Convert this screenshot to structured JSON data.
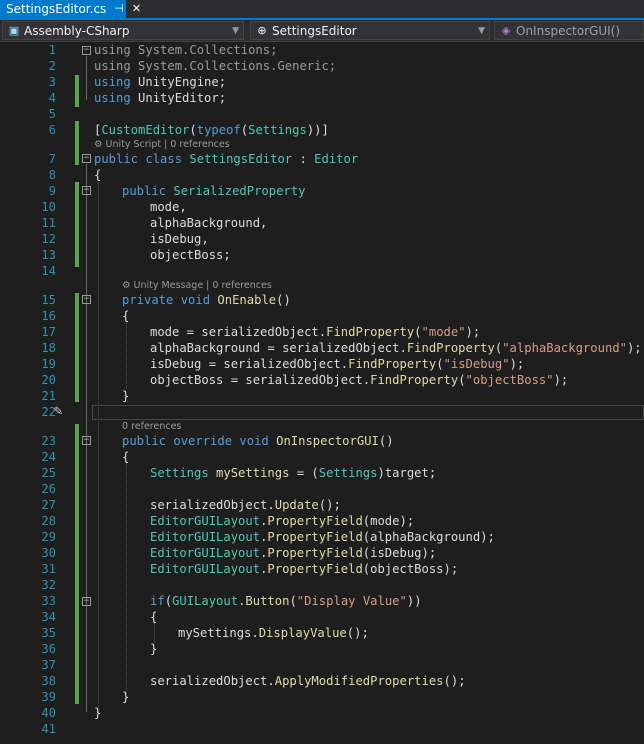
{
  "tab": {
    "title": "SettingsEditor.cs"
  },
  "navbar": {
    "project": "Assembly-CSharp",
    "type": "SettingsEditor",
    "member": "OnInspectorGUI()"
  },
  "lens": {
    "l6": "Unity Script | 0 references",
    "l14": "Unity Message | 0 references",
    "l22": "0 references"
  },
  "lines": [
    "1",
    "2",
    "3",
    "4",
    "5",
    "6",
    "7",
    "8",
    "9",
    "10",
    "11",
    "12",
    "13",
    "14",
    "15",
    "16",
    "17",
    "18",
    "19",
    "20",
    "21",
    "22",
    "23",
    "24",
    "25",
    "26",
    "27",
    "28",
    "29",
    "30",
    "31",
    "32",
    "33",
    "34",
    "35",
    "36",
    "37",
    "38",
    "39",
    "40",
    "41"
  ],
  "code": {
    "l1a": "using",
    "l1b": " System.Collections;",
    "l2a": "using",
    "l2b": " System.Collections.Generic;",
    "l3a": "using",
    "l3b": " UnityEngine;",
    "l4a": "using",
    "l4b": " UnityEditor;",
    "l6a": "[",
    "l6b": "CustomEditor",
    "l6c": "(",
    "l6d": "typeof",
    "l6e": "(",
    "l6f": "Settings",
    "l6g": "))]",
    "l7a": "public",
    "l7b": " ",
    "l7c": "class",
    "l7d": " ",
    "l7e": "SettingsEditor",
    "l7f": " : ",
    "l7g": "Editor",
    "l8": "{",
    "l9a": "public",
    "l9b": " ",
    "l9c": "SerializedProperty",
    "l10": "mode,",
    "l11": "alphaBackground,",
    "l12": "isDebug,",
    "l13": "objectBoss;",
    "l15a": "private",
    "l15b": " ",
    "l15c": "void",
    "l15d": " ",
    "l15e": "OnEnable",
    "l15f": "()",
    "l16": "{",
    "l17a": "mode = serializedObject.",
    "l17b": "FindProperty",
    "l17c": "(",
    "l17d": "\"mode\"",
    "l17e": ");",
    "l18a": "alphaBackground = serializedObject.",
    "l18b": "FindProperty",
    "l18c": "(",
    "l18d": "\"alphaBackground\"",
    "l18e": ");",
    "l19a": "isDebug = serializedObject.",
    "l19b": "FindProperty",
    "l19c": "(",
    "l19d": "\"isDebug\"",
    "l19e": ");",
    "l20a": "objectBoss = serializedObject.",
    "l20b": "FindProperty",
    "l20c": "(",
    "l20d": "\"objectBoss\"",
    "l20e": ");",
    "l21": "}",
    "l23a": "public",
    "l23b": " ",
    "l23c": "override",
    "l23d": " ",
    "l23e": "void",
    "l23f": " ",
    "l23g": "OnInspectorGUI",
    "l23h": "()",
    "l24": "{",
    "l25a": "Settings",
    "l25b": " ",
    "l25c": "mySettings",
    "l25d": " = (",
    "l25e": "Settings",
    "l25f": ")target;",
    "l27a": "serializedObject.",
    "l27b": "Update",
    "l27c": "();",
    "l28a": "EditorGUILayout",
    "l28b": ".",
    "l28c": "PropertyField",
    "l28d": "(mode);",
    "l29a": "EditorGUILayout",
    "l29b": ".",
    "l29c": "PropertyField",
    "l29d": "(alphaBackground);",
    "l30a": "EditorGUILayout",
    "l30b": ".",
    "l30c": "PropertyField",
    "l30d": "(isDebug);",
    "l31a": "EditorGUILayout",
    "l31b": ".",
    "l31c": "PropertyField",
    "l31d": "(objectBoss);",
    "l33a": "if",
    "l33b": "(",
    "l33c": "GUILayout",
    "l33d": ".",
    "l33e": "Button",
    "l33f": "(",
    "l33g": "\"Display Value\"",
    "l33h": "))",
    "l34": "{",
    "l35a": "mySettings.",
    "l35b": "DisplayValue",
    "l35c": "();",
    "l36": "}",
    "l38a": "serializedObject.",
    "l38b": "ApplyModifiedProperties",
    "l38c": "();",
    "l39": "}",
    "l40": "}"
  }
}
